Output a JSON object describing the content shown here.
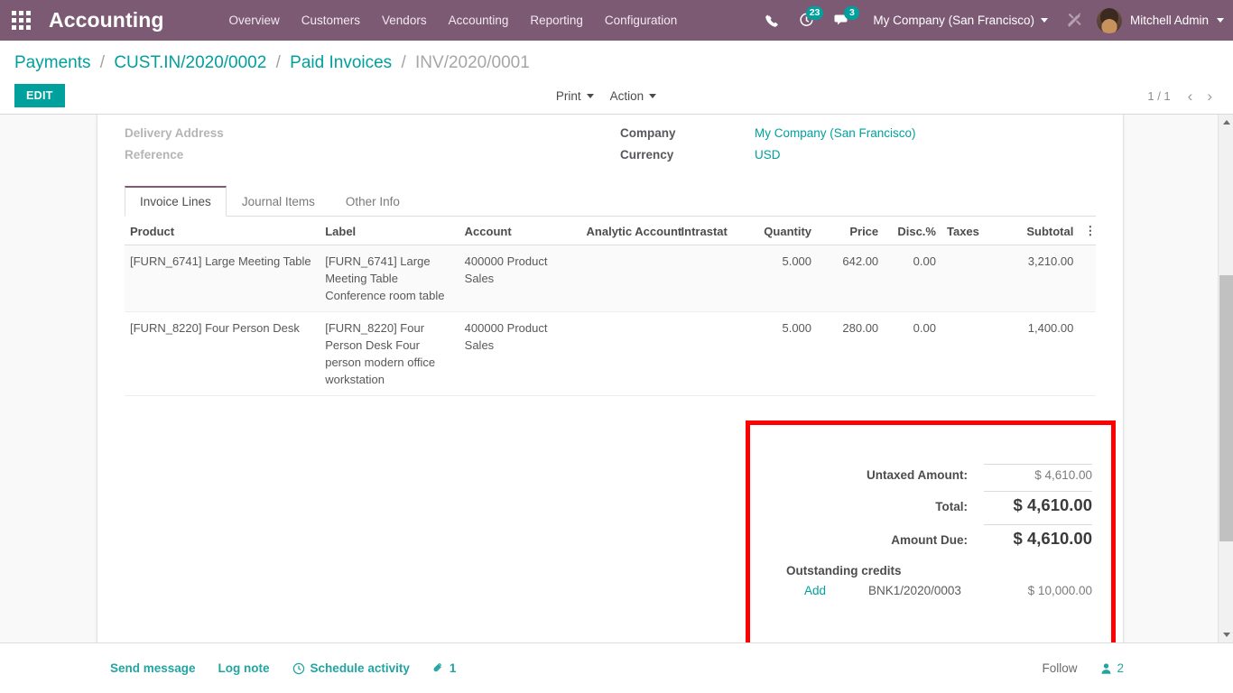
{
  "navbar": {
    "apps_icon": "apps-grid-icon",
    "brand": "Accounting",
    "menu": [
      {
        "label": "Overview"
      },
      {
        "label": "Customers"
      },
      {
        "label": "Vendors"
      },
      {
        "label": "Accounting"
      },
      {
        "label": "Reporting"
      },
      {
        "label": "Configuration"
      }
    ],
    "phone_icon": "phone-icon",
    "activity_icon": "clock-activity-icon",
    "activity_count": "23",
    "messages_icon": "chat-bubble-icon",
    "messages_count": "3",
    "company": "My Company (San Francisco)",
    "debug_icon": "wrench-tools-icon",
    "user": "Mitchell Admin",
    "accent_teal": "#00a09d",
    "navbar_bg": "#7c5a74"
  },
  "control_panel": {
    "breadcrumb": [
      {
        "label": "Payments",
        "active": false
      },
      {
        "label": "CUST.IN/2020/0002",
        "active": false
      },
      {
        "label": "Paid Invoices",
        "active": false
      },
      {
        "label": "INV/2020/0001",
        "active": true
      }
    ],
    "edit_label": "EDIT",
    "print_label": "Print",
    "action_label": "Action",
    "pager_value": "1 / 1",
    "pager_prev_icon": "chevron-left-icon",
    "pager_next_icon": "chevron-right-icon"
  },
  "form": {
    "left_fields": [
      {
        "label": "Delivery Address",
        "value": ""
      },
      {
        "label": "Reference",
        "value": ""
      }
    ],
    "right_fields": [
      {
        "label": "Company",
        "value": "My Company (San Francisco)"
      },
      {
        "label": "Currency",
        "value": "USD"
      }
    ]
  },
  "notebook": {
    "tabs": [
      {
        "label": "Invoice Lines",
        "active": true
      },
      {
        "label": "Journal Items",
        "active": false
      },
      {
        "label": "Other Info",
        "active": false
      }
    ]
  },
  "lines_table": {
    "columns": [
      "Product",
      "Label",
      "Account",
      "Analytic Account",
      "Intrastat",
      "Quantity",
      "Price",
      "Disc.%",
      "Taxes",
      "Subtotal"
    ],
    "options_icon": "vertical-dots-icon",
    "rows": [
      {
        "product": "[FURN_6741] Large Meeting Table",
        "label": "[FURN_6741] Large Meeting Table\nConference room table",
        "account": "400000 Product Sales",
        "analytic": "",
        "intrastat": "",
        "quantity": "5.000",
        "price": "642.00",
        "discount": "0.00",
        "taxes": "",
        "subtotal": "3,210.00"
      },
      {
        "product": "[FURN_8220] Four Person Desk",
        "label": "[FURN_8220] Four Person Desk\nFour person modern office workstation",
        "account": "400000 Product Sales",
        "analytic": "",
        "intrastat": "",
        "quantity": "5.000",
        "price": "280.00",
        "discount": "0.00",
        "taxes": "",
        "subtotal": "1,400.00"
      }
    ]
  },
  "totals": {
    "highlight_color": "#fe0000",
    "untaxed_label": "Untaxed Amount:",
    "untaxed_value": "$ 4,610.00",
    "total_label": "Total:",
    "total_value": "$ 4,610.00",
    "amount_due_label": "Amount Due:",
    "amount_due_value": "$ 4,610.00",
    "outstanding_title": "Outstanding credits",
    "credit": {
      "add_label": "Add",
      "name": "BNK1/2020/0003",
      "amount": "$ 10,000.00"
    }
  },
  "chatter": {
    "send_message": "Send message",
    "log_note": "Log note",
    "schedule_activity": "Schedule activity",
    "schedule_icon": "clock-icon",
    "attachment_icon": "paperclip-icon",
    "attachment_count": "1",
    "follow_label": "Follow",
    "followers_icon": "user-icon",
    "followers_count": "2"
  },
  "scrollbar": {
    "up_icon": "scroll-up-arrow-icon",
    "down_icon": "scroll-down-arrow-icon"
  }
}
